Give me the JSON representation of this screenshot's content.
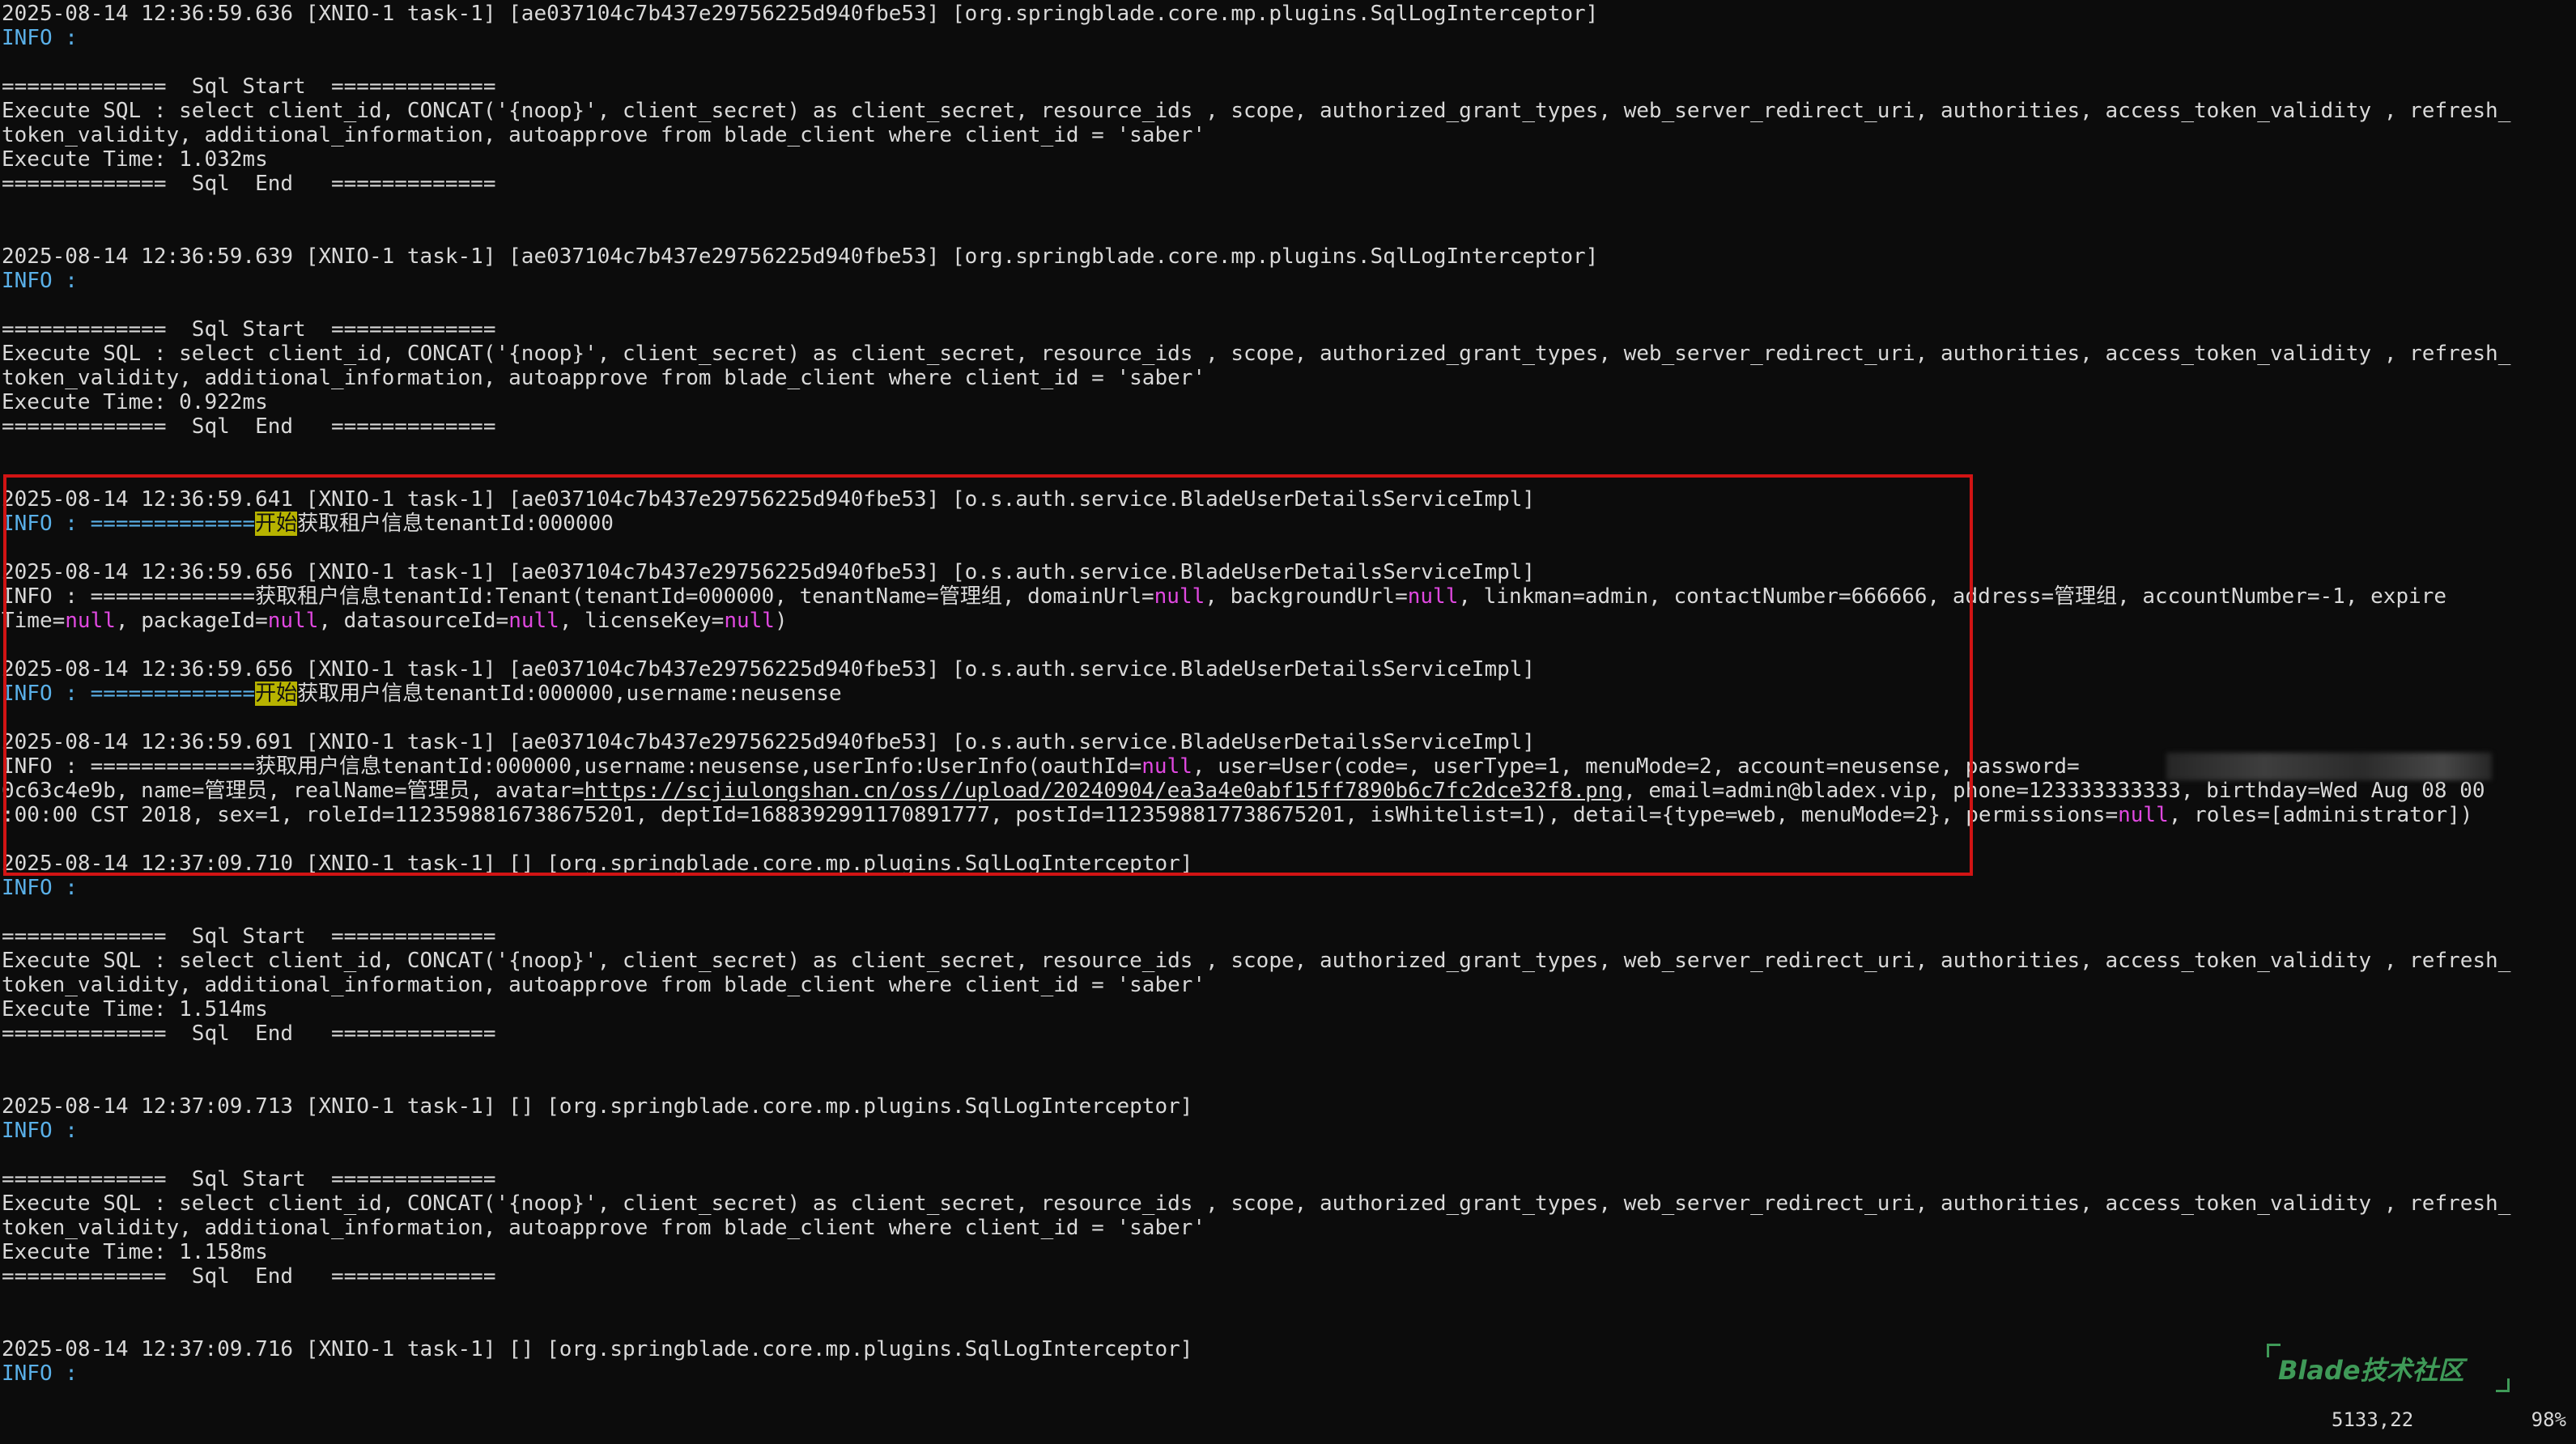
{
  "log": {
    "b1": {
      "header": "2025-08-14 12:36:59.636 [XNIO-1 task-1] [ae037104c7b437e29756225d940fbe53] [org.springblade.core.mp.plugins.SqlLogInterceptor]",
      "info": "INFO :",
      "start": "=============  Sql Start  =============",
      "sql1": "Execute SQL : select client_id, CONCAT('{noop}', client_secret) as client_secret, resource_ids , scope, authorized_grant_types, web_server_redirect_uri, authorities, access_token_validity , refresh_",
      "sql2": "token_validity, additional_information, autoapprove from blade_client where client_id = 'saber'",
      "time": "Execute Time: 1.032ms",
      "end": "=============  Sql  End   ============="
    },
    "b2": {
      "header": "2025-08-14 12:36:59.639 [XNIO-1 task-1] [ae037104c7b437e29756225d940fbe53] [org.springblade.core.mp.plugins.SqlLogInterceptor]",
      "info": "INFO :",
      "start": "=============  Sql Start  =============",
      "sql1": "Execute SQL : select client_id, CONCAT('{noop}', client_secret) as client_secret, resource_ids , scope, authorized_grant_types, web_server_redirect_uri, authorities, access_token_validity , refresh_",
      "sql2": "token_validity, additional_information, autoapprove from blade_client where client_id = 'saber'",
      "time": "Execute Time: 0.922ms",
      "end": "=============  Sql  End   ============="
    },
    "b3": {
      "header": "2025-08-14 12:36:59.641 [XNIO-1 task-1] [ae037104c7b437e29756225d940fbe53] [o.s.auth.service.BladeUserDetailsServiceImpl]",
      "info_prefix": "INFO : =============",
      "hl": "开始",
      "rest": "获取租户信息tenantId:000000"
    },
    "b4": {
      "header": "2025-08-14 12:36:59.656 [XNIO-1 task-1] [ae037104c7b437e29756225d940fbe53] [o.s.auth.service.BladeUserDetailsServiceImpl]",
      "p1": "INFO : =============获取租户信息tenantId:Tenant(tenantId=000000, tenantName=管理组, domainUrl=",
      "null": "null",
      "p2": ", backgroundUrl=",
      "p3": ", linkman=admin, contactNumber=666666, address=管理组, accountNumber=-1, expire",
      "l2a": "Time=",
      "l2b": ", packageId=",
      "l2c": ", datasourceId=",
      "l2d": ", licenseKey=",
      "l2e": ")"
    },
    "b5": {
      "header": "2025-08-14 12:36:59.656 [XNIO-1 task-1] [ae037104c7b437e29756225d940fbe53] [o.s.auth.service.BladeUserDetailsServiceImpl]",
      "info_prefix": "INFO : =============",
      "hl": "开始",
      "rest": "获取用户信息tenantId:000000,username:neusense"
    },
    "b6": {
      "header": "2025-08-14 12:36:59.691 [XNIO-1 task-1] [ae037104c7b437e29756225d940fbe53] [o.s.auth.service.BladeUserDetailsServiceImpl]",
      "p1": "INFO : =============获取用户信息tenantId:000000,username:neusense,userInfo:UserInfo(oauthId=",
      "null": "null",
      "p2": ", user=User(code=, userType=1, menuMode=2, account=neusense, password=",
      "pwd_tail": "152fa4",
      "l2a": "0c63c4e9b, name=管理员, realName=管理员, avatar=",
      "link": "https://scjiulongshan.cn/oss//upload/20240904/ea3a4e0abf15ff7890b6c7fc2dce32f8.png",
      "l2b": ", email=admin@bladex.vip, phone=123333333333, birthday=Wed Aug 08 00",
      "l3a": ":00:00 CST 2018, sex=1, roleId=1123598816738675201, deptId=1688392991170891777, postId=1123598817738675201, isWhitelist=1), detail={type=web, menuMode=2}, permissions=",
      "l3b": ", roles=[administrator])"
    },
    "b7": {
      "header": "2025-08-14 12:37:09.710 [XNIO-1 task-1] [] [org.springblade.core.mp.plugins.SqlLogInterceptor]",
      "info": "INFO :",
      "start": "=============  Sql Start  =============",
      "sql1": "Execute SQL : select client_id, CONCAT('{noop}', client_secret) as client_secret, resource_ids , scope, authorized_grant_types, web_server_redirect_uri, authorities, access_token_validity , refresh_",
      "sql2": "token_validity, additional_information, autoapprove from blade_client where client_id = 'saber'",
      "time": "Execute Time: 1.514ms",
      "end": "=============  Sql  End   ============="
    },
    "b8": {
      "header": "2025-08-14 12:37:09.713 [XNIO-1 task-1] [] [org.springblade.core.mp.plugins.SqlLogInterceptor]",
      "info": "INFO :",
      "start": "=============  Sql Start  =============",
      "sql1": "Execute SQL : select client_id, CONCAT('{noop}', client_secret) as client_secret, resource_ids , scope, authorized_grant_types, web_server_redirect_uri, authorities, access_token_validity , refresh_",
      "sql2": "token_validity, additional_information, autoapprove from blade_client where client_id = 'saber'",
      "time": "Execute Time: 1.158ms",
      "end": "=============  Sql  End   ============="
    },
    "b9": {
      "header": "2025-08-14 12:37:09.716 [XNIO-1 task-1] [] [org.springblade.core.mp.plugins.SqlLogInterceptor]",
      "info": "INFO :"
    }
  },
  "watermark": "Blade技术社区",
  "status": {
    "position": "5133,22",
    "percent": "98%"
  },
  "colors": {
    "background": "#0c0c0c",
    "text": "#d9d9d9",
    "info": "#5ab0e8",
    "null": "#e048e0",
    "highlight": "#b7b300",
    "box": "#d11414",
    "watermark": "#3f9a58"
  }
}
